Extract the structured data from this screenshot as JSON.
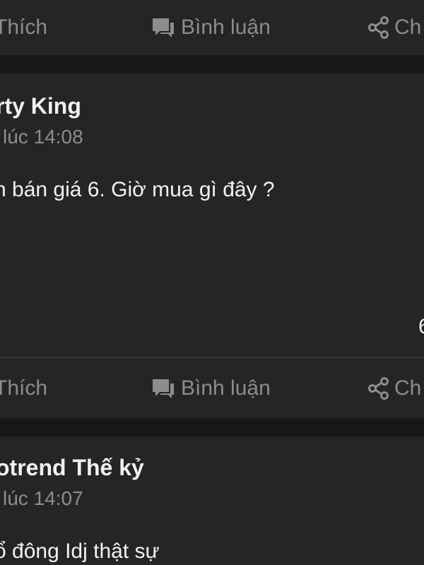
{
  "actions": {
    "like_label": "Thích",
    "comment_label": "Bình luận",
    "share_label": "Ch"
  },
  "posts": [
    {
      "author": "rty King",
      "time": "l lúc 14:08",
      "body": "n bán giá 6. Giờ mua gì đây ?",
      "edge_text": "6"
    },
    {
      "author": "otrend Thế kỷ",
      "time": "l lúc 14:07",
      "body": "ổ đông Idj thật sự"
    }
  ],
  "colors": {
    "background": "#1b1b1b",
    "card": "#252525",
    "separator": "#171717",
    "text_primary": "#f2f2f2",
    "text_secondary": "#8d8d8d"
  },
  "icons": {
    "comment": "comment-bubble-icon",
    "share": "share-icon"
  }
}
